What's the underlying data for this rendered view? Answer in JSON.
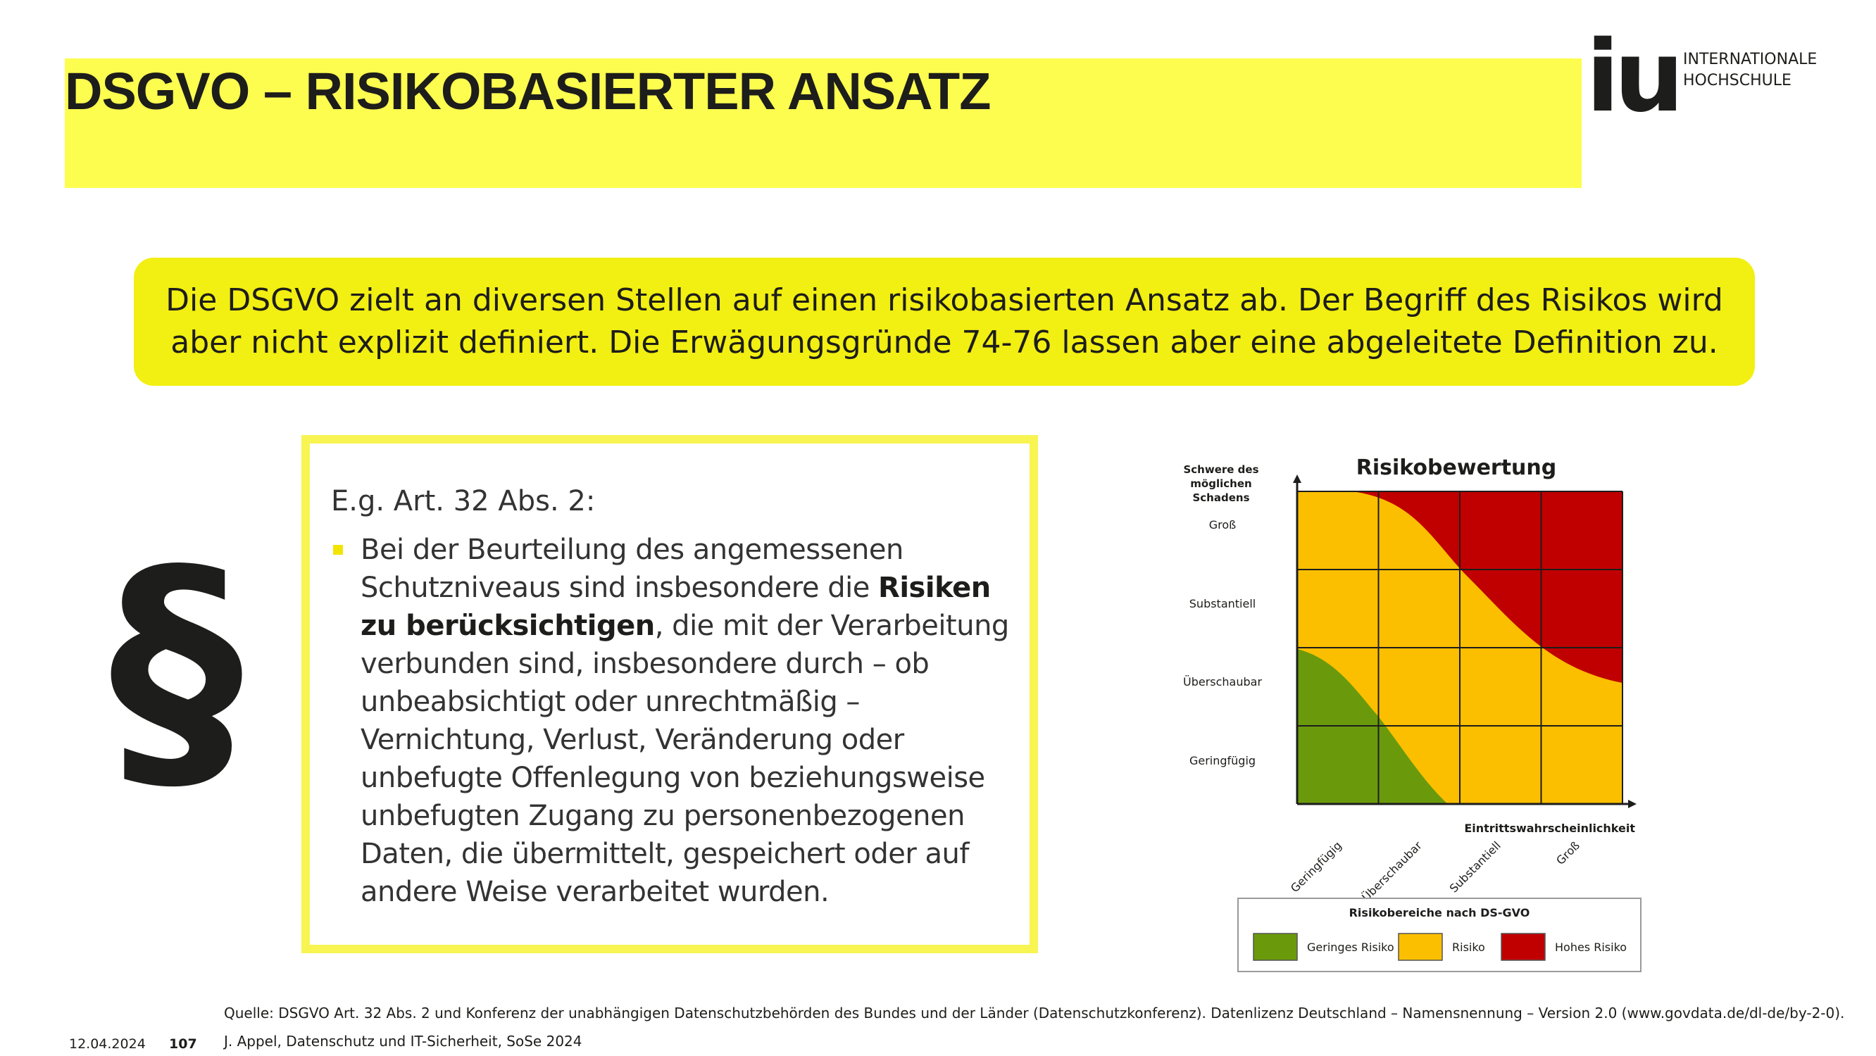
{
  "header": {
    "title": "DSGVO – RISIKOBASIERTER ANSATZ",
    "logo_mark": "iu",
    "logo_line1": "INTERNATIONALE",
    "logo_line2": "HOCHSCHULE"
  },
  "callout": {
    "text": "Die DSGVO zielt an diversen Stellen auf einen risikobasierten Ansatz ab. Der Begriff des Risikos wird aber nicht explizit definiert. Die Erwägungsgründe 74-76 lassen aber eine abgeleitete Definition zu."
  },
  "paragraph_symbol": "§",
  "quote": {
    "heading": "E.g. Art. 32 Abs. 2:",
    "text_before": "Bei der Beurteilung des angemessenen Schutzniveaus sind insbesondere die ",
    "text_bold": "Risiken zu berücksichtigen",
    "text_after": ", die mit der Verarbeitung verbunden sind, insbesondere durch – ob unbeabsichtigt oder unrechtmäßig – Vernichtung, Verlust, Veränderung oder unbefugte Offenlegung von beziehungsweise unbefugten Zugang zu personenbezogenen Daten, die übermittelt, gespeichert oder auf andere Weise verarbeitet wurden."
  },
  "chart_data": {
    "type": "heatmap",
    "title": "Risikobewertung",
    "ylabel_lines": [
      "Schwere des",
      "möglichen",
      "Schadens"
    ],
    "xlabel": "Eintrittswahrscheinlichkeit",
    "y_categories": [
      "Geringfügig",
      "Überschaubar",
      "Substantiell",
      "Groß"
    ],
    "x_categories": [
      "Geringfügig",
      "Überschaubar",
      "Substantiell",
      "Groß"
    ],
    "legend_title": "Risikobereiche nach DS-GVO",
    "legend": [
      {
        "label": "Geringes Risiko",
        "color": "#6a9a0b"
      },
      {
        "label": "Risiko",
        "color": "#fbbf00"
      },
      {
        "label": "Hohes Risiko",
        "color": "#c00000"
      }
    ]
  },
  "footer": {
    "source": "Quelle: DSGVO Art. 32 Abs. 2 und Konferenz der unabhängigen Datenschutzbehörden des Bundes und der Länder (Datenschutzkonferenz). Datenlizenz Deutschland – Namensnennung – Version 2.0 (www.govdata.de/dl-de/by-2-0).",
    "author": "J. Appel, Datenschutz und IT-Sicherheit, SoSe 2024",
    "date": "12.04.2024",
    "page": "107"
  }
}
